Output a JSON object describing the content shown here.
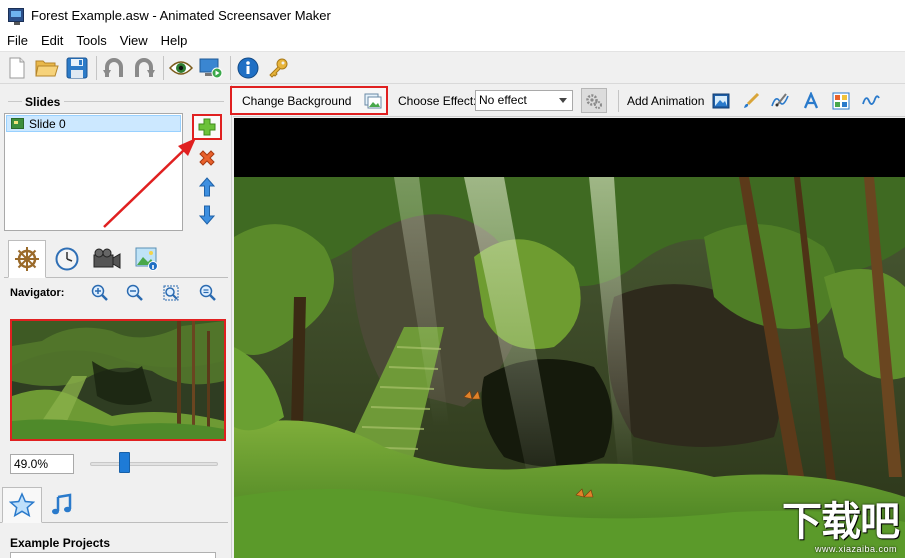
{
  "window": {
    "title": "Forest Example.asw - Animated Screensaver Maker"
  },
  "menu": {
    "items": [
      "File",
      "Edit",
      "Tools",
      "View",
      "Help"
    ]
  },
  "toolbar": {
    "buttons": [
      "new-file-icon",
      "open-folder-icon",
      "save-icon",
      "undo-icon",
      "redo-icon",
      "preview-eye-icon",
      "run-screensaver-icon",
      "info-icon",
      "key-icon"
    ]
  },
  "slides": {
    "label": "Slides",
    "items": [
      {
        "label": "Slide 0"
      }
    ]
  },
  "navigator": {
    "label": "Navigator:",
    "zoom_value": "49.0%",
    "slider_fraction": 0.25
  },
  "projects": {
    "label": "Example Projects"
  },
  "right_toolbar": {
    "change_background_label": "Change Background",
    "choose_effect_label": "Choose Effect:",
    "effect_value": "No effect",
    "add_animation_label": "Add Animation"
  },
  "watermark": {
    "title": "下载吧",
    "url": "www.xiazaiba.com"
  },
  "colors": {
    "highlight_red": "#e02020",
    "selection_blue": "#cce8ff",
    "slider_blue": "#1e7bd7"
  }
}
